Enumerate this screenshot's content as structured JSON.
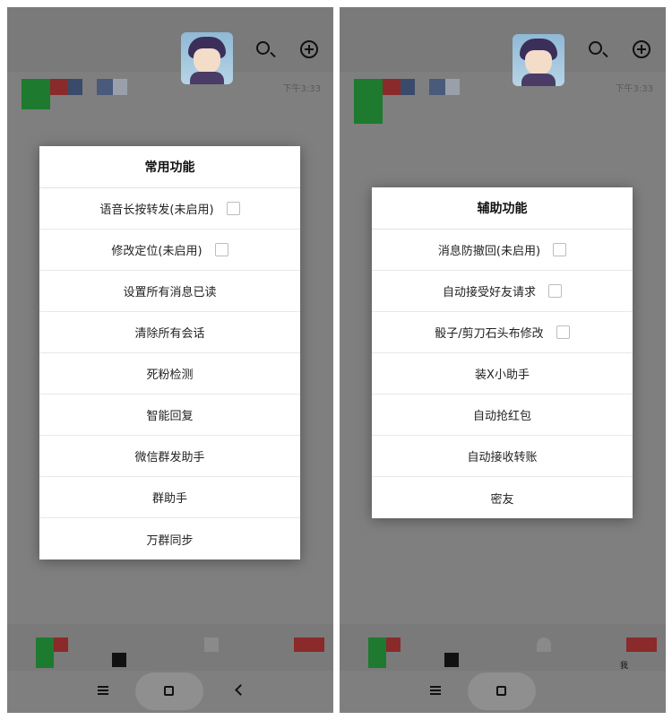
{
  "screens": [
    {
      "chat_time": "下午3:33",
      "dialog": {
        "title": "常用功能",
        "items": [
          {
            "label": "语音长按转发(未启用)",
            "checkbox": true
          },
          {
            "label": "修改定位(未启用)",
            "checkbox": true
          },
          {
            "label": "设置所有消息已读",
            "checkbox": false
          },
          {
            "label": "清除所有会话",
            "checkbox": false
          },
          {
            "label": "死粉检测",
            "checkbox": false
          },
          {
            "label": "智能回复",
            "checkbox": false
          },
          {
            "label": "微信群发助手",
            "checkbox": false
          },
          {
            "label": "群助手",
            "checkbox": false
          },
          {
            "label": "万群同步",
            "checkbox": false
          }
        ]
      }
    },
    {
      "chat_time": "下午3:33",
      "me_label": "我",
      "dialog": {
        "title": "辅助功能",
        "items": [
          {
            "label": "消息防撤回(未启用)",
            "checkbox": true
          },
          {
            "label": "自动接受好友请求",
            "checkbox": true
          },
          {
            "label": "骰子/剪刀石头布修改",
            "checkbox": true
          },
          {
            "label": "装X小助手",
            "checkbox": false
          },
          {
            "label": "自动抢红包",
            "checkbox": false
          },
          {
            "label": "自动接收转账",
            "checkbox": false
          },
          {
            "label": "密友",
            "checkbox": false
          }
        ]
      }
    }
  ],
  "icons": {
    "search": "search-icon",
    "add": "plus-circle-icon",
    "nav_menu": "menu-icon",
    "nav_home": "home-icon",
    "nav_back": "back-icon"
  },
  "colors": {
    "overlay": "#7f7f7f",
    "dialog_bg": "#ffffff",
    "divider": "#e8e8e8"
  }
}
